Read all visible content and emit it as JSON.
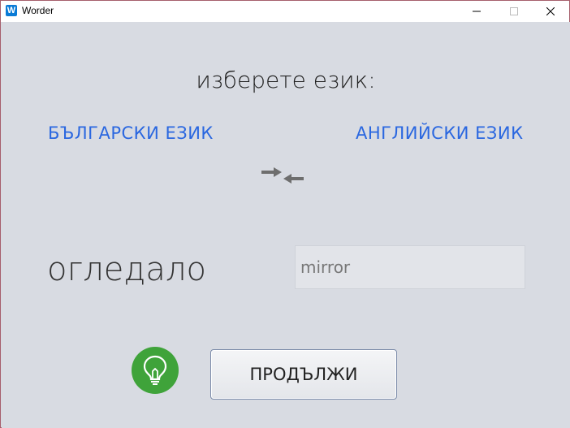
{
  "window": {
    "title": "Worder",
    "icon_letter": "W",
    "minimize_glyph": "—",
    "maximize_glyph": "☐",
    "close_glyph": "✕"
  },
  "main": {
    "heading": "изберете език:",
    "source_language": "БЪЛГАРСКИ ЕЗИК",
    "target_language": "АНГЛИЙСКИ ЕЗИК",
    "swap_icon": "swap-arrows-icon",
    "word": "огледало",
    "answer": {
      "value": "mirror",
      "placeholder": ""
    },
    "hint_icon": "lightbulb-icon",
    "continue_label": "ПРОДЪЛЖИ"
  },
  "colors": {
    "background": "#d8dbe2",
    "link_blue": "#2a67e0",
    "hint_green": "#3fa33a",
    "window_border": "#a65f6c"
  }
}
